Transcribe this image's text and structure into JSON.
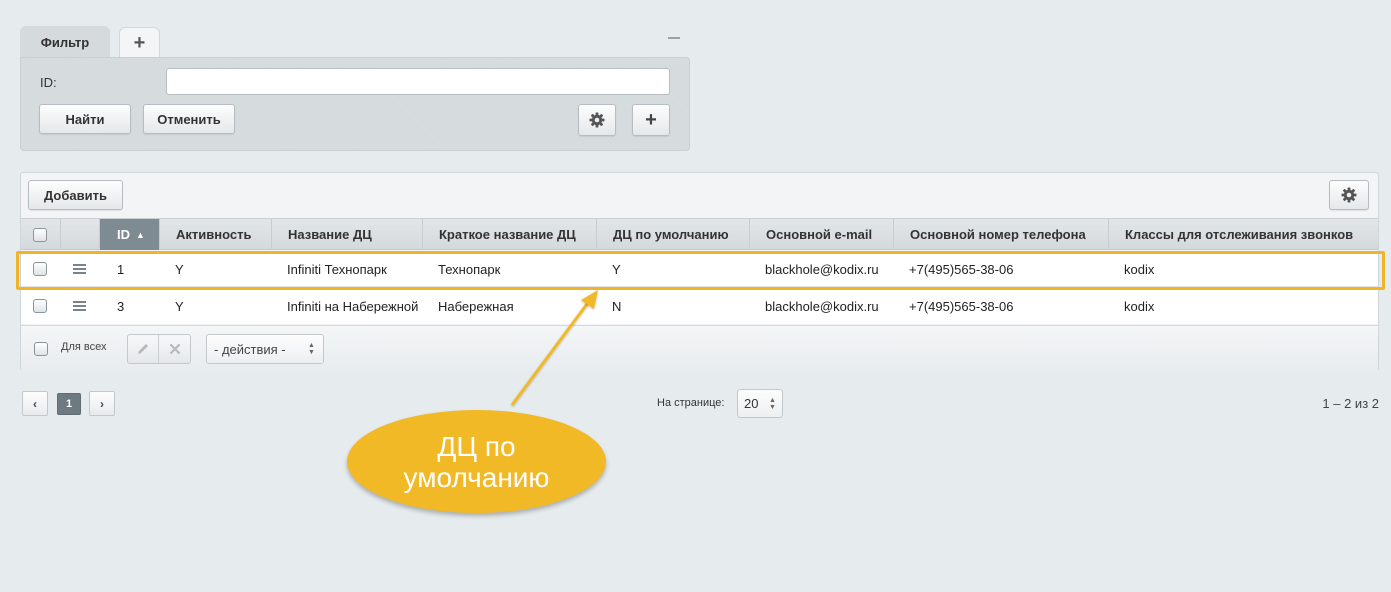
{
  "filter": {
    "tab_label": "Фильтр",
    "add_tab_symbol": "+",
    "id_label": "ID:",
    "id_value": "",
    "find_label": "Найти",
    "cancel_label": "Отменить",
    "plus_symbol": "+"
  },
  "grid": {
    "add_label": "Добавить",
    "columns": [
      "ID",
      "Активность",
      "Название ДЦ",
      "Краткое название ДЦ",
      "ДЦ по умолчанию",
      "Основной e-mail",
      "Основной номер телефона",
      "Классы для отслеживания звонков"
    ],
    "sort_arrow": "▲",
    "rows": [
      {
        "id": "1",
        "active": "Y",
        "name": "Infiniti Технопарк",
        "short_name": "Технопарк",
        "default": "Y",
        "email": "blackhole@kodix.ru",
        "phone": "+7(495)565-38-06",
        "classes": "kodix"
      },
      {
        "id": "3",
        "active": "Y",
        "name": "Infiniti на Набережной",
        "short_name": "Набережная",
        "default": "N",
        "email": "blackhole@kodix.ru",
        "phone": "+7(495)565-38-06",
        "classes": "kodix"
      }
    ],
    "footer": {
      "for_all_label": "Для всех",
      "actions_selected": "- действия -"
    }
  },
  "pagination": {
    "prev_symbol": "‹",
    "current_page": "1",
    "next_symbol": "›",
    "per_page_label": "На странице:",
    "per_page_value": "20",
    "range_text": "1 – 2 из 2"
  },
  "callout": {
    "line1": "ДЦ по",
    "line2": "умолчанию",
    "color": "#f2b926"
  },
  "highlight_color": "#f0b429"
}
